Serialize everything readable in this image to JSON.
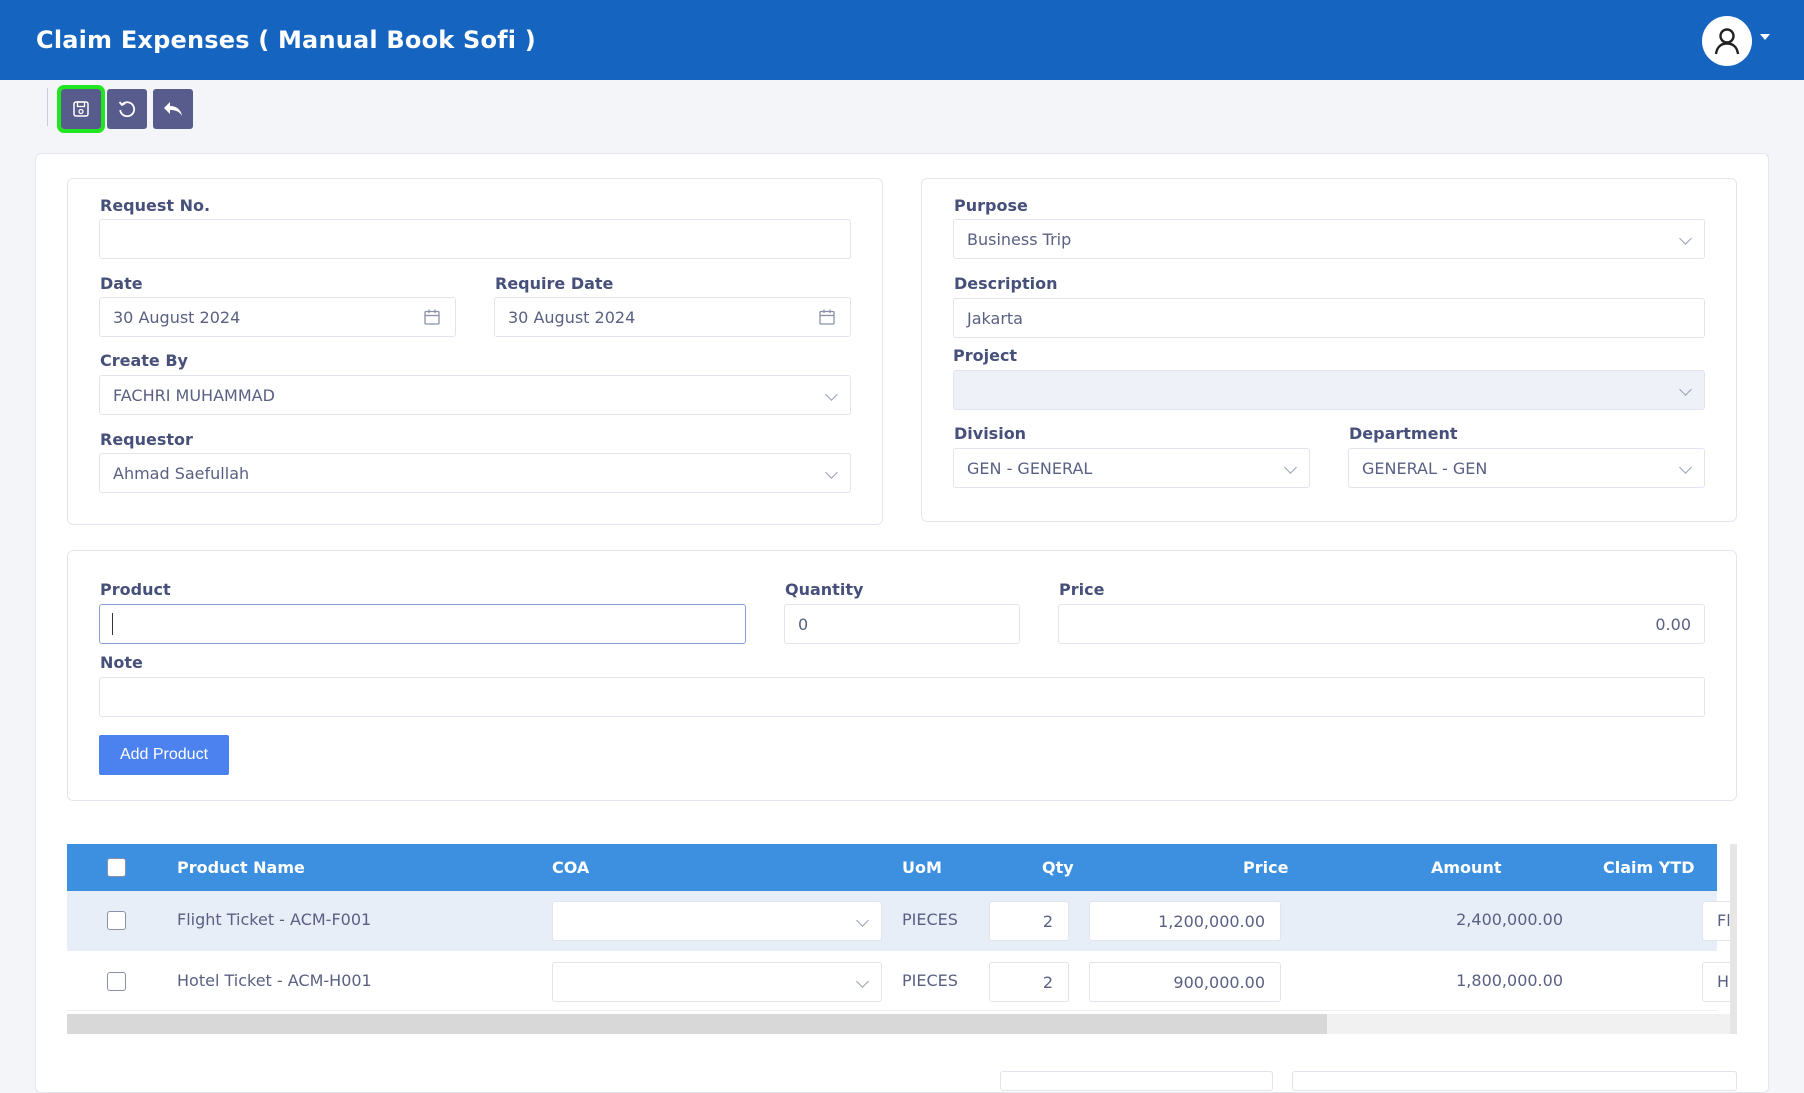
{
  "header": {
    "title": "Claim Expenses ( Manual Book Sofi )"
  },
  "toolbar": {
    "buttons": [
      {
        "icon": "save-icon"
      },
      {
        "icon": "refresh-icon"
      },
      {
        "icon": "undo-icon"
      }
    ]
  },
  "form": {
    "request_no": {
      "label": "Request No.",
      "value": ""
    },
    "date": {
      "label": "Date",
      "value": "30 August 2024"
    },
    "require_date": {
      "label": "Require Date",
      "value": "30 August 2024"
    },
    "create_by": {
      "label": "Create By",
      "value": "FACHRI MUHAMMAD"
    },
    "requestor": {
      "label": "Requestor",
      "value": "Ahmad Saefullah"
    },
    "purpose": {
      "label": "Purpose",
      "value": "Business Trip"
    },
    "description": {
      "label": "Description",
      "value": "Jakarta"
    },
    "project": {
      "label": "Project",
      "value": ""
    },
    "division": {
      "label": "Division",
      "value": "GEN - GENERAL"
    },
    "department": {
      "label": "Department",
      "value": "GENERAL - GEN"
    }
  },
  "product_entry": {
    "product": {
      "label": "Product",
      "value": ""
    },
    "quantity": {
      "label": "Quantity",
      "value": "0"
    },
    "price": {
      "label": "Price",
      "value": "0.00"
    },
    "note": {
      "label": "Note",
      "value": ""
    },
    "add_button": "Add Product"
  },
  "table": {
    "columns": [
      "Product Name",
      "COA",
      "UoM",
      "Qty",
      "Price",
      "Amount",
      "Claim YTD"
    ],
    "rows": [
      {
        "product": "Flight Ticket - ACM-F001",
        "coa": "",
        "uom": "PIECES",
        "qty": "2",
        "price": "1,200,000.00",
        "amount": "2,400,000.00",
        "claim_ytd_clip": "Fl"
      },
      {
        "product": "Hotel Ticket - ACM-H001",
        "coa": "",
        "uom": "PIECES",
        "qty": "2",
        "price": "900,000.00",
        "amount": "1,800,000.00",
        "claim_ytd_clip": "H"
      }
    ]
  },
  "colors": {
    "header_bg": "#1565c0",
    "toolbar_btn": "#575c8c",
    "active_outline": "#1fe61f",
    "table_header": "#3d8fe0",
    "primary_button": "#4b82f0"
  }
}
